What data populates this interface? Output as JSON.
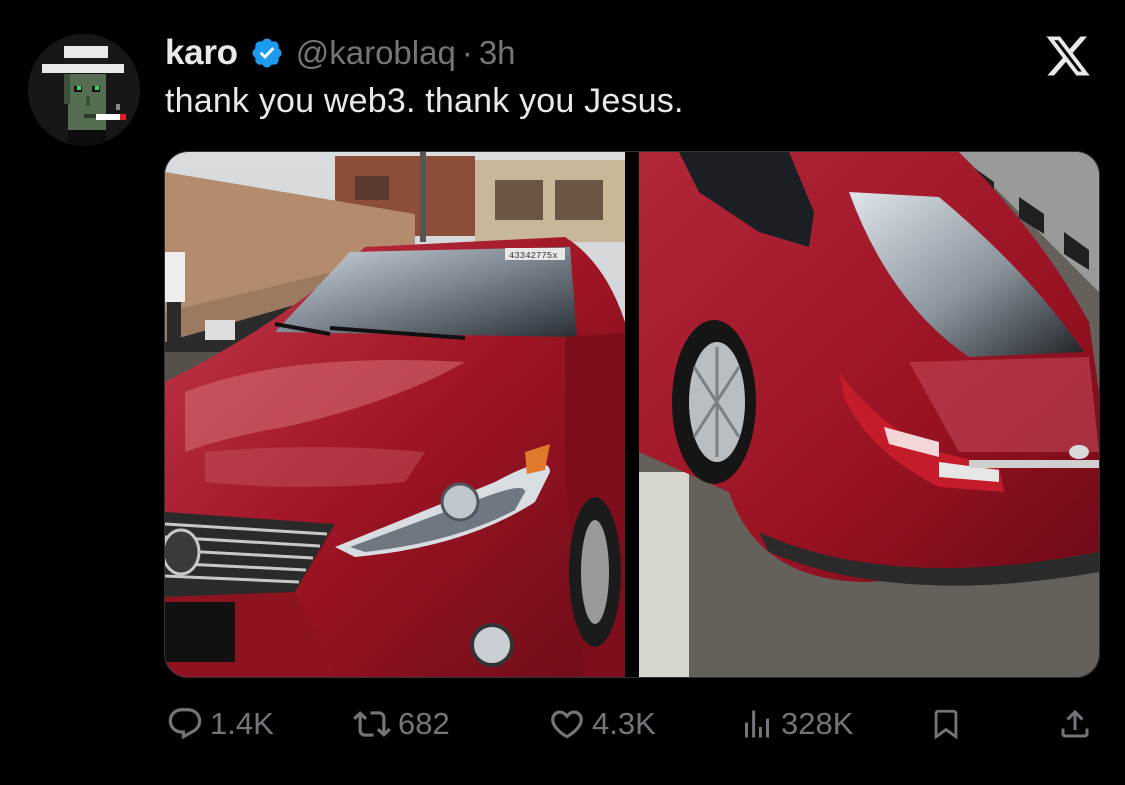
{
  "tweet": {
    "author_name": "karo",
    "verified": true,
    "handle": "@karoblaq",
    "separator": "·",
    "timestamp": "3h",
    "text": "thank you web3. thank you Jesus."
  },
  "media": {
    "count": 2,
    "left_photo": {
      "windshield_sticker_text": "43342775x"
    }
  },
  "actions": {
    "replies": "1.4K",
    "reposts": "682",
    "likes": "4.3K",
    "views": "328K"
  },
  "icons": {
    "platform_logo": "x-logo-icon",
    "reply": "reply-icon",
    "repost": "repost-icon",
    "like": "heart-icon",
    "views": "views-chart-icon",
    "bookmark": "bookmark-icon",
    "share": "share-icon"
  },
  "colors": {
    "background": "#000000",
    "text_primary": "#e7e9ea",
    "text_secondary": "#71767b",
    "verified_badge": "#1d9bf0",
    "car_red": "#9e1424"
  }
}
